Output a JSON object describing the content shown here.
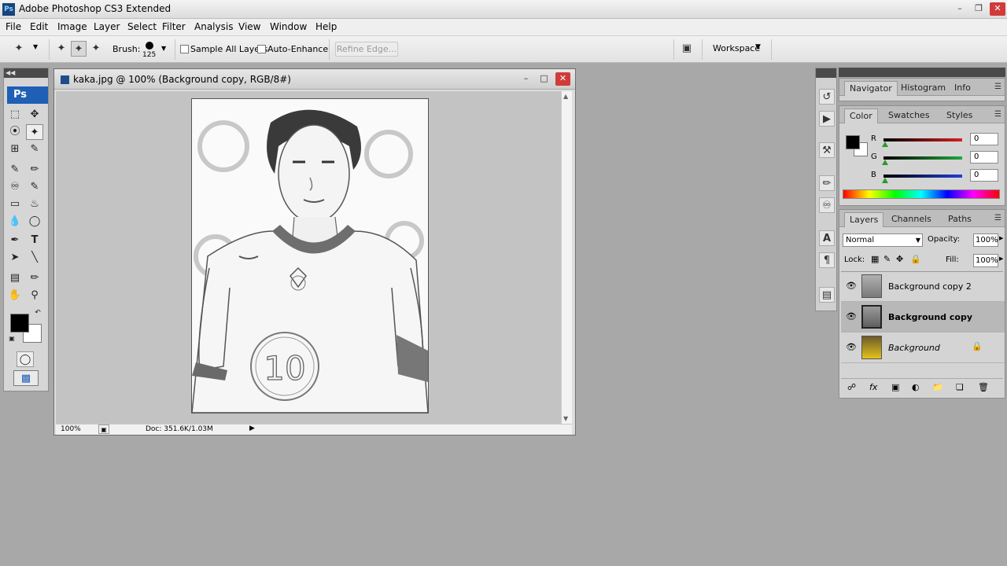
{
  "app": {
    "title": "Adobe Photoshop CS3 Extended",
    "logo": "Ps"
  },
  "menu": [
    "File",
    "Edit",
    "Image",
    "Layer",
    "Select",
    "Filter",
    "Analysis",
    "View",
    "Window",
    "Help"
  ],
  "options": {
    "brush_label": "Brush:",
    "brush_size": "125",
    "sample_all_layers": "Sample All Layers",
    "auto_enhance": "Auto-Enhance",
    "refine_edge": "Refine Edge...",
    "workspace": "Workspace"
  },
  "toolbox": {
    "logo": "Ps"
  },
  "document": {
    "title": "kaka.jpg @ 100% (Background copy, RGB/8#)",
    "zoom": "100%",
    "doc_size": "Doc: 351.6K/1.03M",
    "photo_number": "10"
  },
  "panels": {
    "group1_tabs": [
      "Navigator",
      "Histogram",
      "Info"
    ],
    "group2_tabs": [
      "Color",
      "Swatches",
      "Styles"
    ],
    "color": {
      "r_label": "R",
      "g_label": "G",
      "b_label": "B",
      "r": "0",
      "g": "0",
      "b": "0",
      "foreground": "#000000",
      "r_color": "#d81f1f",
      "g_color": "#1fa83a",
      "b_color": "#1f3fd8"
    },
    "layers_tabs": [
      "Layers",
      "Channels",
      "Paths"
    ],
    "layers": {
      "blend_mode": "Normal",
      "opacity_label": "Opacity:",
      "opacity": "100%",
      "lock_label": "Lock:",
      "fill_label": "Fill:",
      "fill": "100%",
      "items": [
        {
          "name": "Background copy 2"
        },
        {
          "name": "Background copy"
        },
        {
          "name": "Background"
        }
      ]
    }
  }
}
